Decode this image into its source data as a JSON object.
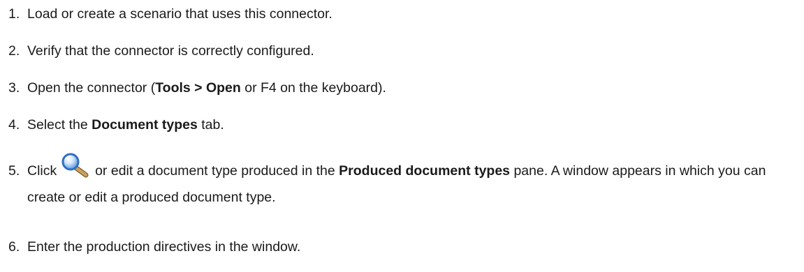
{
  "steps": [
    {
      "number": "1.",
      "text": "Load or create a scenario that uses this connector."
    },
    {
      "number": "2.",
      "text": "Verify that the connector is correctly configured."
    },
    {
      "number": "3.",
      "before": "Open the connector (",
      "bold": "Tools > Open",
      "after": " or F4 on the keyboard)."
    },
    {
      "number": "4.",
      "before": "Select the ",
      "bold": "Document types",
      "after": " tab."
    },
    {
      "number": "5.",
      "before": "Click ",
      "icon": "magnifier-icon",
      "middle": " or edit a document type produced in the ",
      "bold": "Produced document types",
      "after": " pane. A window appears in which you can create or edit a produced document type."
    },
    {
      "number": "6.",
      "text": "Enter the production directives in the window."
    }
  ],
  "colors": {
    "text": "#1a1a1a",
    "icon_lens": "#2f6fc4",
    "icon_handle": "#c9a15a"
  }
}
